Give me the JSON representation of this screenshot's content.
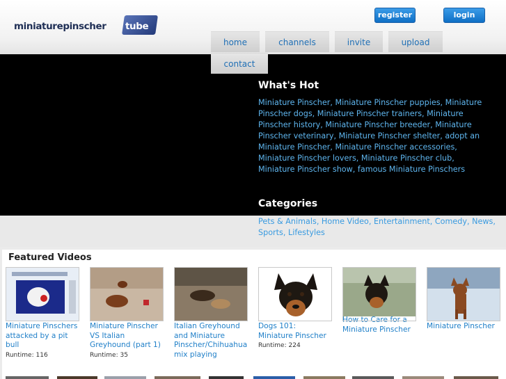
{
  "site": {
    "logo_main": "miniaturepinscher",
    "logo_tube": "tube"
  },
  "auth": {
    "register": "register",
    "login": "login"
  },
  "nav": {
    "home": "home",
    "channels": "channels",
    "invite": "invite",
    "upload": "upload",
    "contact": "contact"
  },
  "whats_hot": {
    "title": "What's Hot",
    "links": "Miniature Pinscher, Miniature Pinscher puppies, Miniature Pinscher dogs, Miniature Pinscher trainers, Miniature Pinscher history, Miniature Pinscher breeder, Miniature Pinscher veterinary, Miniature Pinscher shelter, adopt an Miniature Pinscher, Miniature Pinscher accessories, Miniature Pinscher lovers, Miniature Pinscher club, Miniature Pinscher show, famous Miniature Pinschers"
  },
  "categories": {
    "title": "Categories",
    "links": "Pets & Animals, Home Video, Entertainment, Comedy, News, Sports, Lifestyles"
  },
  "featured": {
    "title": "Featured Videos",
    "runtime_label": "Runtime:",
    "videos": [
      {
        "title": "Miniature Pinschers attacked by a pit bull",
        "runtime": "116"
      },
      {
        "title": "Miniature Pinscher VS Italian Greyhound (part 1)",
        "runtime": "35"
      },
      {
        "title": "Italian Greyhound and Miniature Pinscher/Chihuahua mix playing",
        "runtime": ""
      },
      {
        "title": "Dogs 101: Miniature Pinscher",
        "runtime": "224"
      },
      {
        "title": "How to Care for a Miniature Pinscher",
        "runtime": ""
      },
      {
        "title": "Miniature Pinscher",
        "runtime": ""
      }
    ]
  },
  "colors": {
    "link": "#3a9be0",
    "button": "#1a7fd6",
    "hero_bg": "#000000"
  }
}
